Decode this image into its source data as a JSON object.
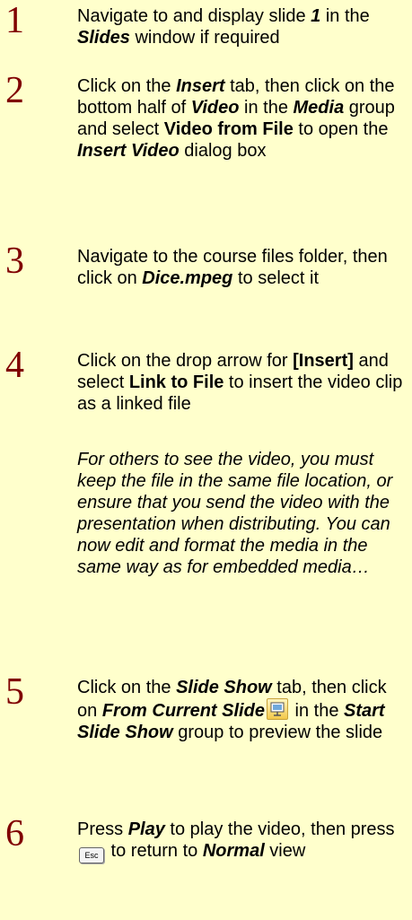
{
  "steps": [
    {
      "number": "1",
      "parts": [
        "Navigate to and display slide ",
        "1",
        " in the ",
        "Slides",
        " window if required"
      ]
    },
    {
      "number": "2",
      "parts": [
        "Click on the ",
        "Insert",
        " tab, then click on the bottom half of ",
        "Video",
        " in the ",
        "Media",
        " group and select ",
        "Video from File",
        " to open the ",
        "Insert Video",
        " dialog box"
      ]
    },
    {
      "number": "3",
      "parts": [
        "Navigate to the course files folder, then click on ",
        "Dice.mpeg",
        " to select it"
      ]
    },
    {
      "number": "4",
      "parts": [
        "Click on the drop arrow for ",
        "[Insert]",
        " and select ",
        "Link to File",
        " to insert the video clip as a linked file"
      ],
      "note": "For others to see the video, you must keep the file in the same file location, or ensure that you send the video with the presentation when distributing. You can now edit and format the media in the same way as for embedded media…"
    },
    {
      "number": "5",
      "parts": [
        "Click on the ",
        "Slide Show",
        " tab, then click on ",
        "From Current Slide",
        "",
        " in the ",
        "Start Slide Show",
        " group to preview the slide"
      ],
      "icon": "slide-show-from-current-icon"
    },
    {
      "number": "6",
      "parts": [
        "Press ",
        "Play",
        " to play the video, then press ",
        "Esc",
        " to return to ",
        "Normal",
        " view"
      ],
      "icon": "esc-key-icon"
    }
  ]
}
